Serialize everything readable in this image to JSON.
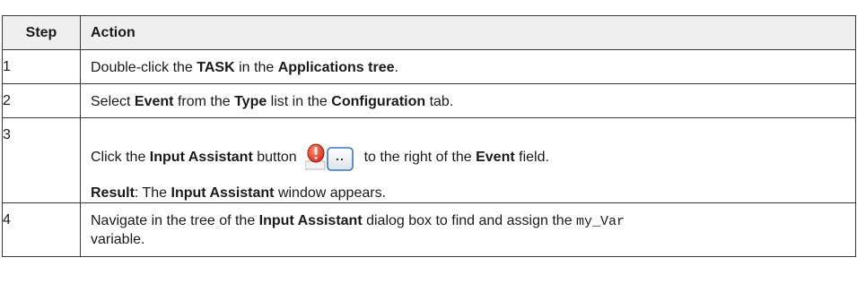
{
  "headers": {
    "step": "Step",
    "action": "Action"
  },
  "rows": [
    {
      "num": "1",
      "parts": [
        "Double-click the ",
        "TASK",
        " in the ",
        "Applications tree",
        "."
      ]
    },
    {
      "num": "2",
      "parts": [
        "Select ",
        "Event",
        " from the ",
        "Type",
        " list in the ",
        "Configuration",
        " tab."
      ]
    },
    {
      "num": "3",
      "line1_parts": [
        "Click the ",
        "Input Assistant",
        " button ",
        " to the right of the ",
        "Event",
        " field."
      ],
      "line2_parts": [
        "Result",
        ": The ",
        "Input Assistant",
        " window appears."
      ],
      "icon": "input-assistant-button-icon"
    },
    {
      "num": "4",
      "parts": [
        "Navigate in the tree of the ",
        "Input Assistant",
        " dialog box to find and assign the ",
        "my_Var",
        " variable."
      ]
    }
  ],
  "colors": {
    "header_bg": "#efefef",
    "border": "#3a3a3a",
    "alert_red": "#e23b25"
  }
}
